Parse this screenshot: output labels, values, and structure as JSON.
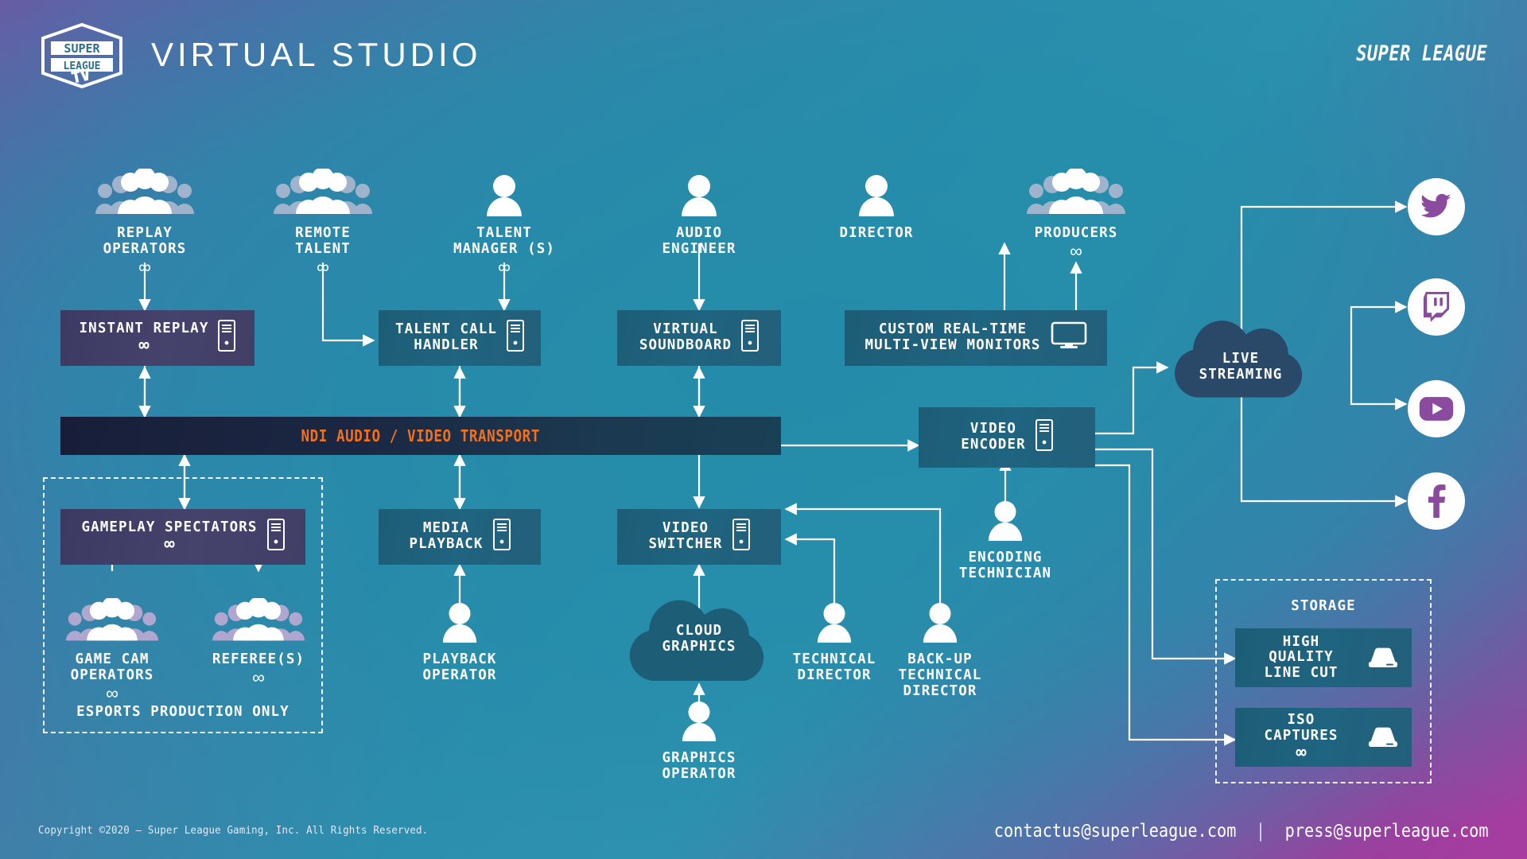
{
  "header": {
    "logo_lines": [
      "SUPER",
      "LEAGUE",
      "TV"
    ],
    "title": "VIRTUAL STUDIO",
    "brand_right": "SUPER LEAGUE"
  },
  "footer": {
    "copyright": "Copyright ©2020 — Super League Gaming, Inc. All Rights Reserved.",
    "email_contact": "contactus@superleague.com",
    "separator": "|",
    "email_press": "press@superleague.com"
  },
  "infinity": "∞",
  "transport_bar": {
    "label": "NDI AUDIO / VIDEO TRANSPORT",
    "color": "#f2701d"
  },
  "roles": [
    {
      "id": "replay-operators",
      "label": "REPLAY\nOPERATORS",
      "icon": "people-group-icon",
      "infinite": true
    },
    {
      "id": "remote-talent",
      "label": "REMOTE\nTALENT",
      "icon": "people-group-icon",
      "infinite": true
    },
    {
      "id": "talent-manager",
      "label": "TALENT\nMANAGER (S)",
      "icon": "person-icon",
      "infinite": true
    },
    {
      "id": "audio-engineer",
      "label": "AUDIO\nENGINEER",
      "icon": "person-icon",
      "infinite": false
    },
    {
      "id": "director",
      "label": "DIRECTOR",
      "icon": "person-icon",
      "infinite": false
    },
    {
      "id": "producers",
      "label": "PRODUCERS",
      "icon": "people-group-icon",
      "infinite": true
    },
    {
      "id": "game-cam-operators",
      "label": "GAME CAM\nOPERATORS",
      "icon": "people-group-icon",
      "infinite": true
    },
    {
      "id": "referees",
      "label": "REFEREE(S)",
      "icon": "people-group-icon",
      "infinite": true
    },
    {
      "id": "playback-operator",
      "label": "PLAYBACK\nOPERATOR",
      "icon": "person-icon",
      "infinite": false
    },
    {
      "id": "graphics-operator",
      "label": "GRAPHICS\nOPERATOR",
      "icon": "person-icon",
      "infinite": false
    },
    {
      "id": "technical-director",
      "label": "TECHNICAL\nDIRECTOR",
      "icon": "person-icon",
      "infinite": false
    },
    {
      "id": "backup-technical-director",
      "label": "BACK-UP\nTECHNICAL\nDIRECTOR",
      "icon": "person-icon",
      "infinite": false
    },
    {
      "id": "encoding-technician",
      "label": "ENCODING\nTECHNICIAN",
      "icon": "person-icon",
      "infinite": false
    }
  ],
  "systems": [
    {
      "id": "instant-replay",
      "label": "INSTANT REPLAY",
      "icon": "server-tower-icon",
      "infinite": true,
      "style": "purple"
    },
    {
      "id": "talent-call-handler",
      "label": "TALENT CALL\nHANDLER",
      "icon": "server-tower-icon",
      "infinite": false,
      "style": "teal"
    },
    {
      "id": "virtual-soundboard",
      "label": "VIRTUAL\nSOUNDBOARD",
      "icon": "server-tower-icon",
      "infinite": false,
      "style": "teal"
    },
    {
      "id": "multiview-monitors",
      "label": "CUSTOM REAL-TIME\nMULTI-VIEW MONITORS",
      "icon": "monitor-icon",
      "infinite": false,
      "style": "teal"
    },
    {
      "id": "gameplay-spectators",
      "label": "GAMEPLAY SPECTATORS",
      "icon": "server-tower-icon",
      "infinite": true,
      "style": "purple"
    },
    {
      "id": "media-playback",
      "label": "MEDIA\nPLAYBACK",
      "icon": "server-tower-icon",
      "infinite": false,
      "style": "teal"
    },
    {
      "id": "video-switcher",
      "label": "VIDEO\nSWITCHER",
      "icon": "server-tower-icon",
      "infinite": false,
      "style": "teal"
    },
    {
      "id": "video-encoder",
      "label": "VIDEO\nENCODER",
      "icon": "server-tower-icon",
      "infinite": false,
      "style": "teal"
    },
    {
      "id": "high-quality-line-cut",
      "label": "HIGH QUALITY\nLINE CUT",
      "icon": "hard-drive-icon",
      "infinite": false,
      "style": "teal"
    },
    {
      "id": "iso-captures",
      "label": "ISO CAPTURES",
      "icon": "hard-drive-icon",
      "infinite": true,
      "style": "teal"
    }
  ],
  "clouds": [
    {
      "id": "cloud-graphics",
      "label": "CLOUD\nGRAPHICS"
    },
    {
      "id": "live-streaming",
      "label": "LIVE\nSTREAMING"
    }
  ],
  "groups": [
    {
      "id": "esports-production-only",
      "label": "ESPORTS PRODUCTION ONLY"
    },
    {
      "id": "storage",
      "label": "STORAGE"
    }
  ],
  "destinations": [
    {
      "id": "twitter",
      "icon": "twitter-icon"
    },
    {
      "id": "twitch",
      "icon": "twitch-icon"
    },
    {
      "id": "youtube",
      "icon": "youtube-icon"
    },
    {
      "id": "facebook",
      "icon": "facebook-icon"
    }
  ],
  "colors": {
    "accent_orange": "#f2701d",
    "box_teal": "#1f6480",
    "box_purple": "#413f66",
    "cloud_dark": "#2a4968",
    "cloud_teal": "#1d5d76",
    "line": "#ffffff"
  }
}
